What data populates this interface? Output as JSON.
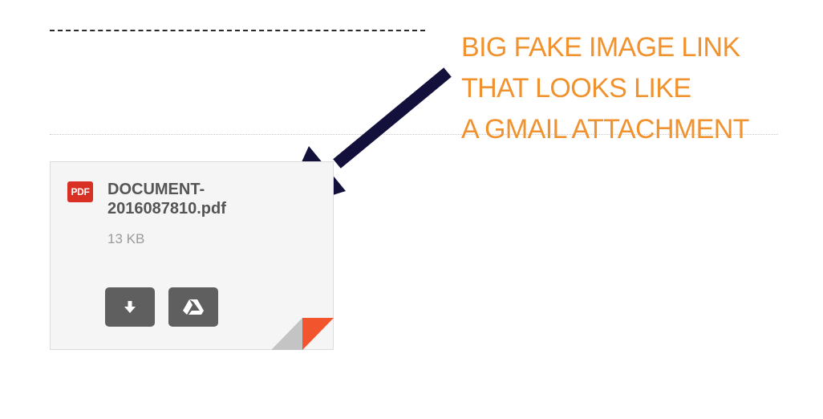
{
  "annotation": {
    "lines": [
      "BIG FAKE IMAGE LINK",
      "THAT LOOKS LIKE",
      "A GMAIL ATTACHMENT"
    ],
    "text_color": "#f0922e",
    "arrow_color": "#13103c"
  },
  "attachment": {
    "file_type_badge": "PDF",
    "file_name_line1": "DOCUMENT-",
    "file_name_line2": "2016087810.pdf",
    "file_size": "13 KB",
    "download_icon": "download-arrow-icon",
    "drive_icon": "google-drive-icon",
    "colors": {
      "badge": "#d93025",
      "file_name": "#555555",
      "file_size": "#9a9a9a",
      "button": "#5f5f5f",
      "fold_gray": "#c4c4c4",
      "fold_red": "#f2542d"
    }
  }
}
